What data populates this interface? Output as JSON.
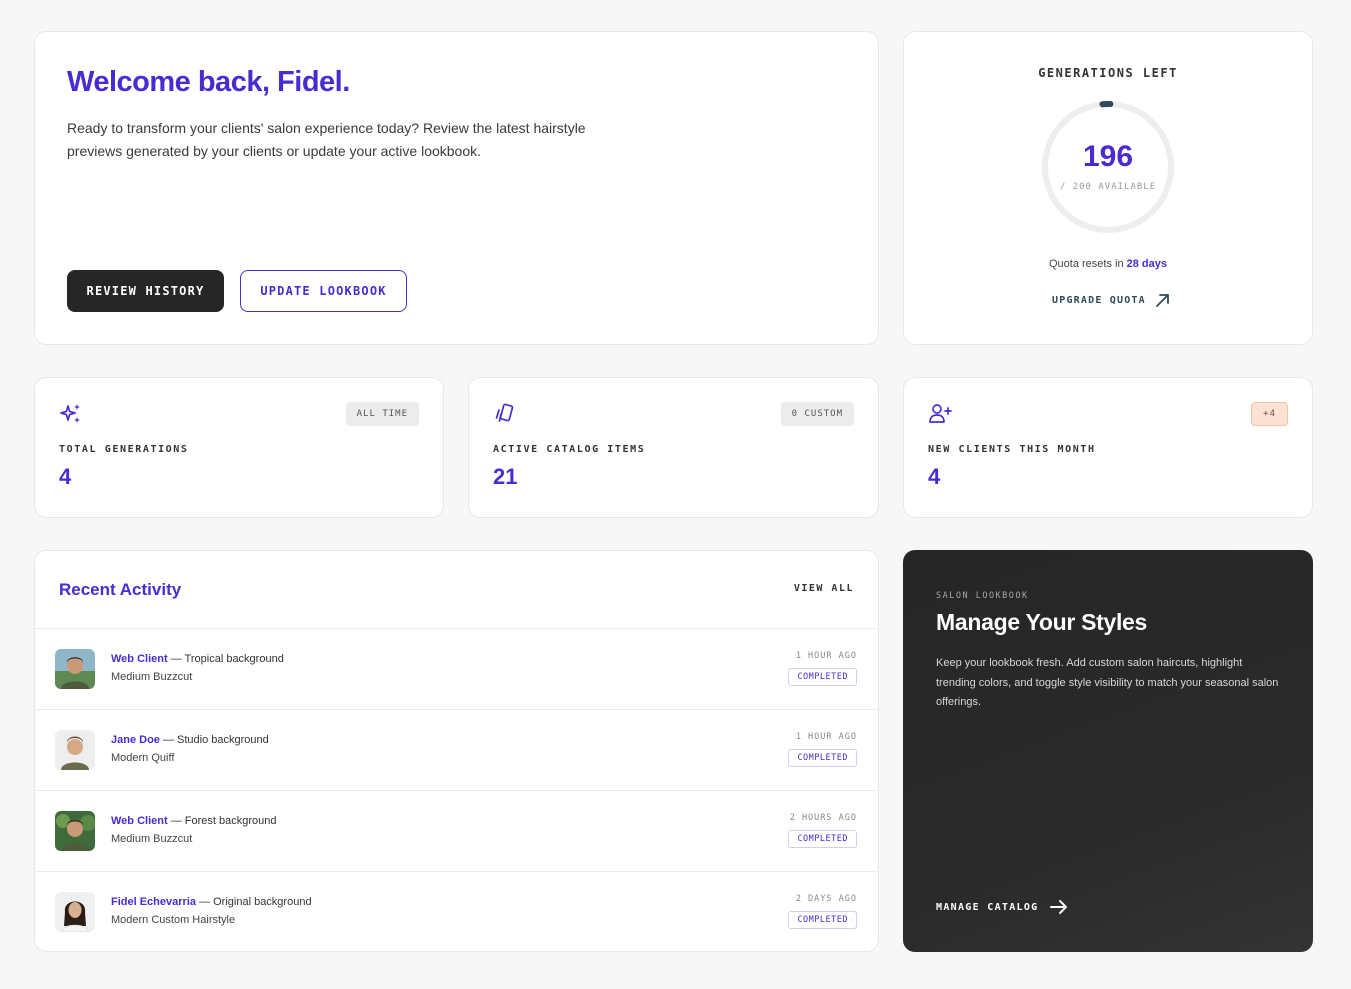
{
  "welcome": {
    "title": "Welcome back, Fidel.",
    "description": "Ready to transform your clients' salon experience today? Review the latest hairstyle previews generated by your clients or update your active lookbook.",
    "review_label": "REVIEW HISTORY",
    "lookbook_label": "UPDATE LOOKBOOK"
  },
  "quota": {
    "title": "GENERATIONS LEFT",
    "remaining": "196",
    "available": "/ 200 AVAILABLE",
    "total": 200,
    "reset_prefix": "Quota resets in ",
    "reset_days": "28 days",
    "upgrade_label": "UPGRADE QUOTA"
  },
  "stats": [
    {
      "label": "TOTAL GENERATIONS",
      "value": "4",
      "badge": "ALL TIME",
      "icon": "sparkles-icon"
    },
    {
      "label": "ACTIVE CATALOG ITEMS",
      "value": "21",
      "badge": "0 CUSTOM",
      "icon": "card-stack-icon"
    },
    {
      "label": "NEW CLIENTS THIS MONTH",
      "value": "4",
      "badge": "+4",
      "icon": "user-plus-icon"
    }
  ],
  "activity": {
    "title": "Recent Activity",
    "view_all": "VIEW ALL",
    "rows": [
      {
        "who": "Web Client",
        "bg": " — Tropical background",
        "style": "Medium Buzzcut",
        "time": "1 HOUR AGO",
        "status": "COMPLETED"
      },
      {
        "who": "Jane Doe",
        "bg": " — Studio background",
        "style": "Modern Quiff",
        "time": "1 HOUR AGO",
        "status": "COMPLETED"
      },
      {
        "who": "Web Client",
        "bg": " — Forest background",
        "style": "Medium Buzzcut",
        "time": "2 HOURS AGO",
        "status": "COMPLETED"
      },
      {
        "who": "Fidel Echevarria",
        "bg": " — Original background",
        "style": "Modern Custom Hairstyle",
        "time": "2 DAYS AGO",
        "status": "COMPLETED"
      }
    ]
  },
  "promo": {
    "kicker": "SALON LOOKBOOK",
    "title": "Manage Your Styles",
    "body": "Keep your lookbook fresh. Add custom salon haircuts, highlight trending colors, and toggle style visibility to match your seasonal salon offerings.",
    "cta": "MANAGE CATALOG"
  },
  "colors": {
    "accent": "#4a2bd1",
    "dark": "#262626",
    "ring_track": "#eeeeee",
    "ring_fill": "#2f4a5c"
  }
}
